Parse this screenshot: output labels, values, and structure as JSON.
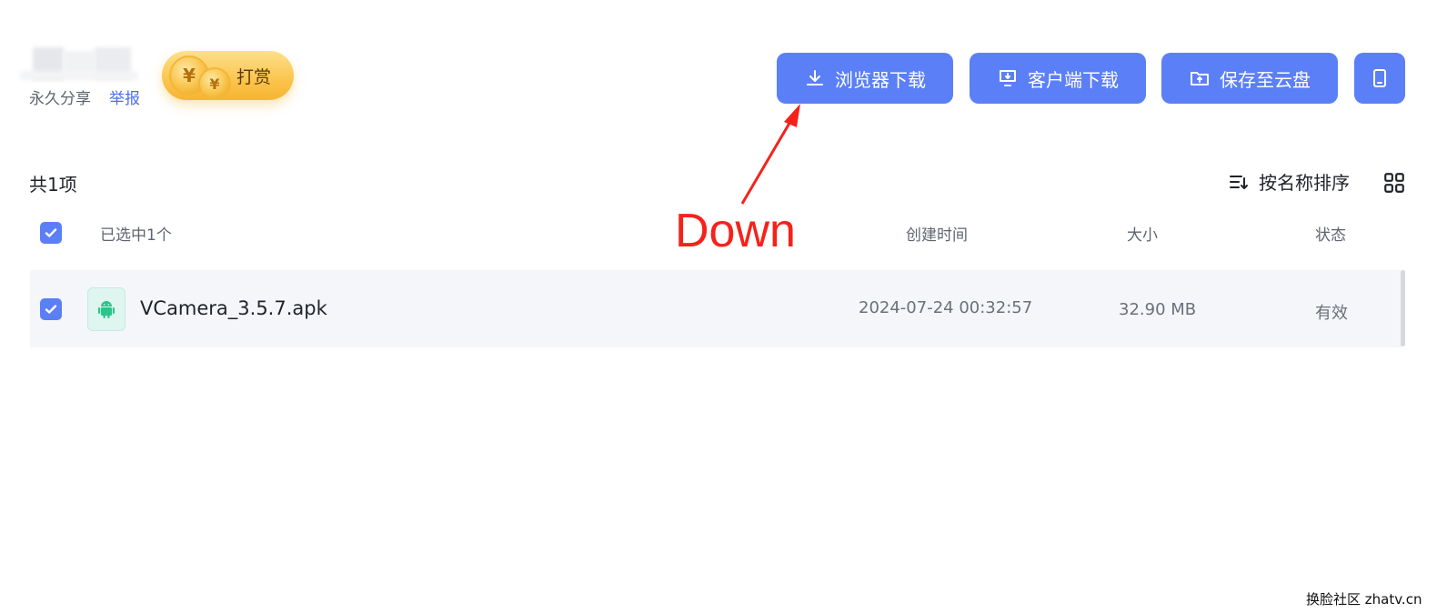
{
  "header": {
    "share_label": "永久分享",
    "report_link": "举报",
    "tip_button_label": "打赏",
    "coin_symbol": "¥"
  },
  "actions": {
    "browser_download": "浏览器下载",
    "client_download": "客户端下载",
    "save_to_cloud": "保存至云盘"
  },
  "list_toolbar": {
    "total": "共1项",
    "sort_label": "按名称排序"
  },
  "table": {
    "headers": {
      "selected": "已选中1个",
      "created": "创建时间",
      "size": "大小",
      "status": "状态"
    },
    "rows": [
      {
        "name": "VCamera_3.5.7.apk",
        "created": "2024-07-24 00:32:57",
        "size": "32.90 MB",
        "status": "有效",
        "checked": true
      }
    ]
  },
  "annotation": {
    "text": "Down",
    "color": "#f5221b"
  },
  "watermark": "换脸社区 zhatv.cn",
  "colors": {
    "primary": "#5b7ff7",
    "link": "#4e6ef2",
    "row_bg": "#f4f6fa",
    "android_green": "#2bc48a"
  }
}
